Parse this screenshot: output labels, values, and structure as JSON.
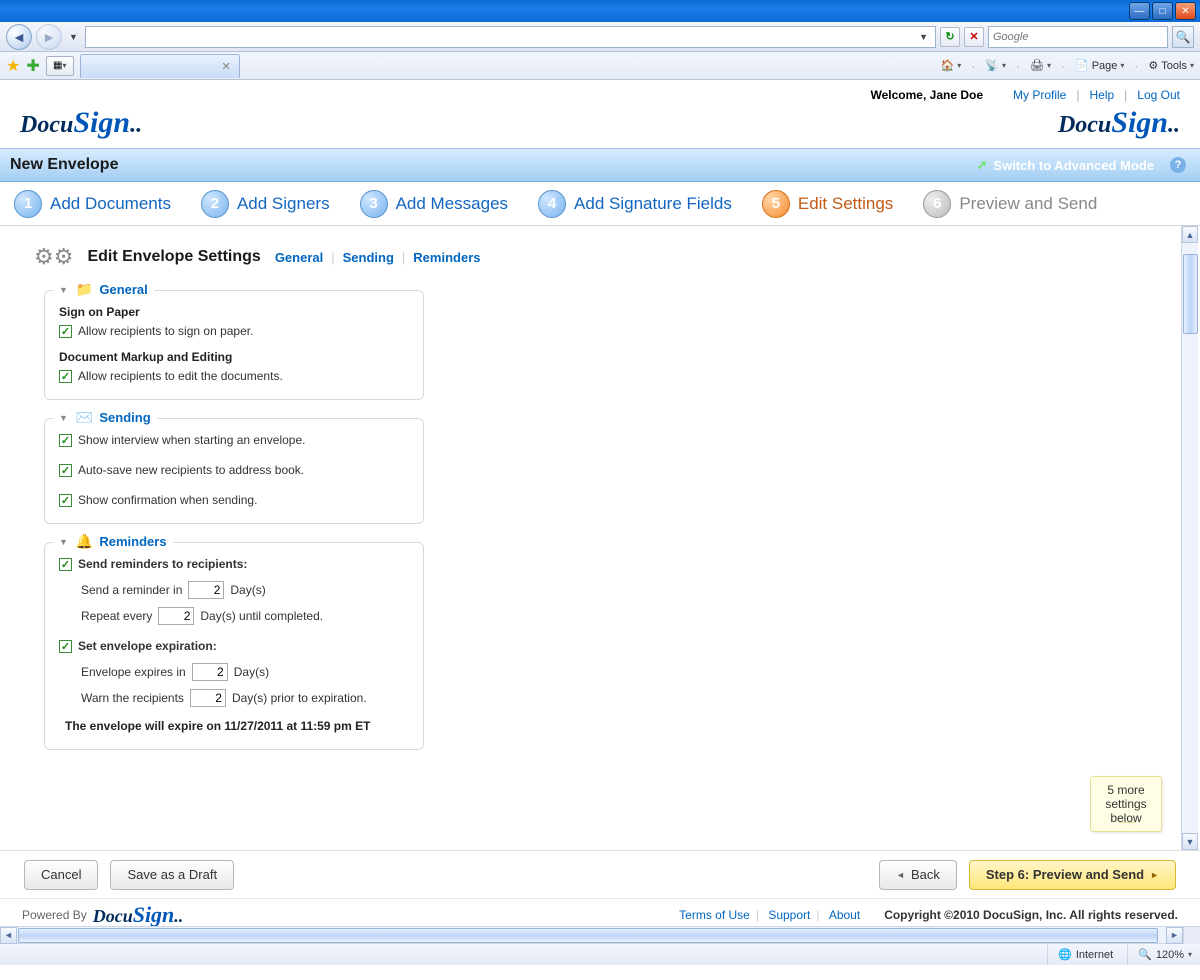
{
  "browser": {
    "search_placeholder": "Google",
    "cmd_page": "Page",
    "cmd_tools": "Tools",
    "status_internet": "Internet",
    "status_zoom": "120%",
    "tab_title": " "
  },
  "header": {
    "welcome": "Welcome, Jane Doe",
    "links": {
      "profile": "My Profile",
      "help": "Help",
      "logout": "Log Out"
    }
  },
  "envelope_bar": {
    "title": "New Envelope",
    "advanced": "Switch to Advanced Mode"
  },
  "steps": [
    {
      "num": "1",
      "label": "Add Documents",
      "state": "normal"
    },
    {
      "num": "2",
      "label": "Add Signers",
      "state": "normal"
    },
    {
      "num": "3",
      "label": "Add Messages",
      "state": "normal"
    },
    {
      "num": "4",
      "label": "Add Signature Fields",
      "state": "normal"
    },
    {
      "num": "5",
      "label": "Edit Settings",
      "state": "active"
    },
    {
      "num": "6",
      "label": "Preview and Send",
      "state": "disabled"
    }
  ],
  "settings": {
    "title": "Edit Envelope Settings",
    "tabs": [
      "General",
      "Sending",
      "Reminders"
    ]
  },
  "general": {
    "legend": "General",
    "sign_head": "Sign on Paper",
    "sign_opt": "Allow recipients to sign on paper.",
    "markup_head": "Document Markup and Editing",
    "markup_opt": "Allow recipients to edit the documents."
  },
  "sending": {
    "legend": "Sending",
    "opt1": "Show interview when starting an envelope.",
    "opt2": "Auto-save new recipients to address book.",
    "opt3": "Show confirmation when sending."
  },
  "reminders": {
    "legend": "Reminders",
    "send_head": "Send reminders to recipients:",
    "row1_pre": "Send a reminder in",
    "row1_val": "2",
    "row1_post": "Day(s)",
    "row2_pre": "Repeat every",
    "row2_val": "2",
    "row2_post": "Day(s) until completed.",
    "exp_head": "Set envelope expiration:",
    "exp1_pre": "Envelope expires in",
    "exp1_val": "2",
    "exp1_post": "Day(s)",
    "exp2_pre": "Warn the recipients",
    "exp2_val": "2",
    "exp2_post": "Day(s) prior to expiration.",
    "note": "The envelope will expire on 11/27/2011 at 11:59 pm ET"
  },
  "callout": {
    "l1": "5 more",
    "l2": "settings",
    "l3": "below"
  },
  "buttons": {
    "cancel": "Cancel",
    "save_draft": "Save as a Draft",
    "back": "Back",
    "next": "Step 6: Preview and Send"
  },
  "footer": {
    "powered": "Powered By",
    "terms": "Terms of Use",
    "support": "Support",
    "about": "About",
    "copyright": "Copyright ©2010 DocuSign, Inc. All rights reserved."
  }
}
